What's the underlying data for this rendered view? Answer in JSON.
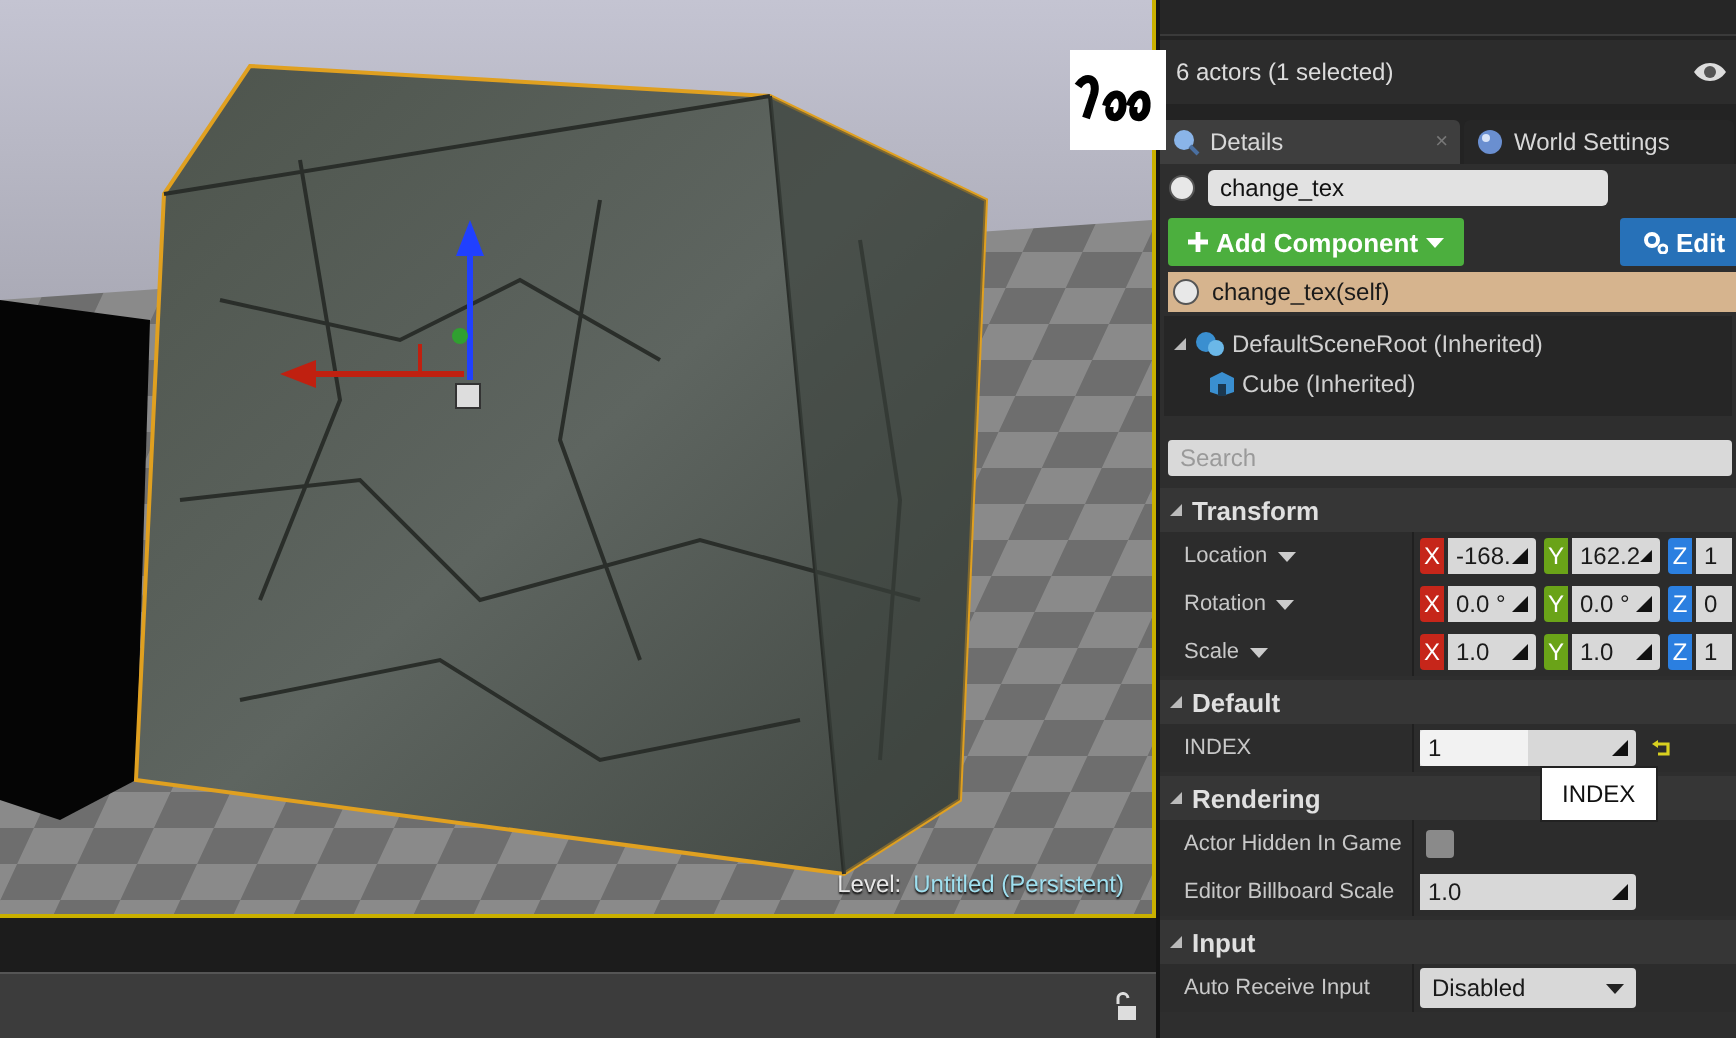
{
  "viewport": {
    "level_label": "Level:",
    "level_name": "Untitled (Persistent)"
  },
  "outliner": {
    "actor_count": "6 actors (1 selected)"
  },
  "tabs": [
    {
      "label": "Details",
      "selected": true,
      "close": "×"
    },
    {
      "label": "World Settings",
      "selected": false
    }
  ],
  "details": {
    "name_value": "change_tex",
    "add_button": "Add Component",
    "edit_button": "Edit",
    "self_item": "change_tex(self)",
    "components": [
      {
        "label": "DefaultSceneRoot (Inherited)",
        "expanded": true,
        "children": [
          {
            "label": "Cube (Inherited)"
          }
        ]
      }
    ],
    "search": {
      "placeholder": "Search"
    },
    "sections": [
      {
        "title": "Transform",
        "expanded": true,
        "rows": [
          {
            "kind": "vector",
            "label": "Location",
            "dropdown": true,
            "values": [
              {
                "axis": "X",
                "value": "-168.",
                "color": "#c6261a"
              },
              {
                "axis": "Y",
                "value": "162.2",
                "color": "#6aa318"
              },
              {
                "axis": "Z",
                "value": "1",
                "color": "#2b7fe0"
              }
            ]
          },
          {
            "kind": "vector",
            "label": "Rotation",
            "dropdown": true,
            "values": [
              {
                "axis": "X",
                "value": "0.0 °",
                "color": "#c6261a"
              },
              {
                "axis": "Y",
                "value": "0.0 °",
                "color": "#6aa318"
              },
              {
                "axis": "Z",
                "value": "0",
                "color": "#2b7fe0"
              }
            ]
          },
          {
            "kind": "vector",
            "label": "Scale",
            "dropdown": true,
            "values": [
              {
                "axis": "X",
                "value": "1.0",
                "color": "#c6261a"
              },
              {
                "axis": "Y",
                "value": "1.0",
                "color": "#6aa318"
              },
              {
                "axis": "Z",
                "value": "1",
                "color": "#2b7fe0"
              }
            ]
          }
        ]
      },
      {
        "title": "Default",
        "expanded": true,
        "rows": [
          {
            "kind": "slider",
            "label": "INDEX",
            "value": "1",
            "level": 0.5,
            "resettable": true,
            "tooltip": "INDEX"
          }
        ]
      },
      {
        "title": "Rendering",
        "expanded": true,
        "rows": [
          {
            "kind": "checkbox",
            "label": "Actor Hidden In Game",
            "checked": false
          },
          {
            "kind": "number",
            "label": "Editor Billboard Scale",
            "value": "1.0"
          }
        ]
      },
      {
        "title": "Input",
        "expanded": true,
        "rows": [
          {
            "kind": "dropdown",
            "label": "Auto Receive Input",
            "value": "Disabled"
          }
        ]
      }
    ]
  }
}
